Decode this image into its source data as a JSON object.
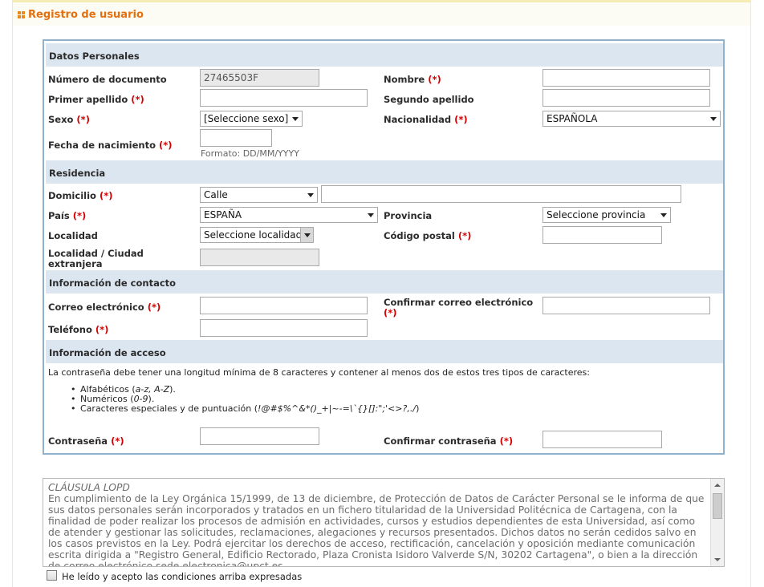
{
  "page": {
    "title": "Registro de usuario"
  },
  "required_mark": "(*)",
  "sections": {
    "personal": "Datos Personales",
    "residence": "Residencia",
    "contact": "Información de contacto",
    "access": "Información de acceso"
  },
  "personal": {
    "doc_number_label": "Número de documento",
    "doc_number_value": "27465503F",
    "nombre_label": "Nombre",
    "primer_apellido_label": "Primer apellido",
    "segundo_apellido_label": "Segundo apellido",
    "sexo_label": "Sexo",
    "sexo_value": "[Seleccione sexo]",
    "nacionalidad_label": "Nacionalidad",
    "nacionalidad_value": "ESPAÑOLA",
    "fecha_label": "Fecha de nacimiento",
    "fecha_hint": "Formato: DD/MM/YYYY"
  },
  "residence": {
    "domicilio_label": "Domicilio",
    "domicilio_type": "Calle",
    "pais_label": "País",
    "pais_value": "ESPAÑA",
    "provincia_label": "Provincia",
    "provincia_value": "Seleccione provincia",
    "localidad_label": "Localidad",
    "localidad_value": "Seleccione localidad",
    "codigo_postal_label": "Código postal",
    "localidad_ext_label_1": "Localidad / Ciudad",
    "localidad_ext_label_2": "extranjera"
  },
  "contact": {
    "correo_label": "Correo electrónico",
    "confirmar_correo_label": "Confirmar correo electrónico",
    "telefono_label": "Teléfono"
  },
  "access": {
    "rules_intro": "La contraseña debe tener una longitud mínima de 8 caracteres y contener al menos dos de estos tres tipos de caracteres:",
    "rules": [
      {
        "text": "Alfabéticos (",
        "example": "a-z, A-Z",
        "suffix": ")."
      },
      {
        "text": "Numéricos (",
        "example": "0-9",
        "suffix": ")."
      },
      {
        "text": "Caracteres especiales y de puntuación (",
        "example": "!@#$%^&*()_+|~-=\\`{}[]:\";'<>?,./",
        "suffix": ")"
      }
    ],
    "password_label": "Contraseña",
    "confirm_password_label": "Confirmar contraseña"
  },
  "lopd": {
    "title": "CLÁUSULA LOPD",
    "body": "En cumplimiento de la Ley Orgánica 15/1999, de 13 de diciembre, de Protección de Datos de Carácter Personal se le informa de que sus datos personales serán incorporados y tratados en un fichero titularidad de la Universidad Politécnica de Cartagena, con la finalidad de poder realizar los procesos de admisión en actividades, cursos y estudios dependientes de esta Universidad, así como de atender y gestionar las solicitudes, reclamaciones, alegaciones y recursos presentados. Dichos datos no serán cedidos salvo en los casos previstos en la Ley. Podrá ejercitar los derechos de acceso, rectificación, cancelación y oposición mediante comunicación escrita dirigida a \"Registro General, Edificio Rectorado, Plaza Cronista Isidoro Valverde S/N, 30202 Cartagena\", o bien a la dirección de correo electrónico sede.electronica@upct.es"
  },
  "accept": {
    "label": "He leído y acepto las condiciones arriba expresadas"
  }
}
